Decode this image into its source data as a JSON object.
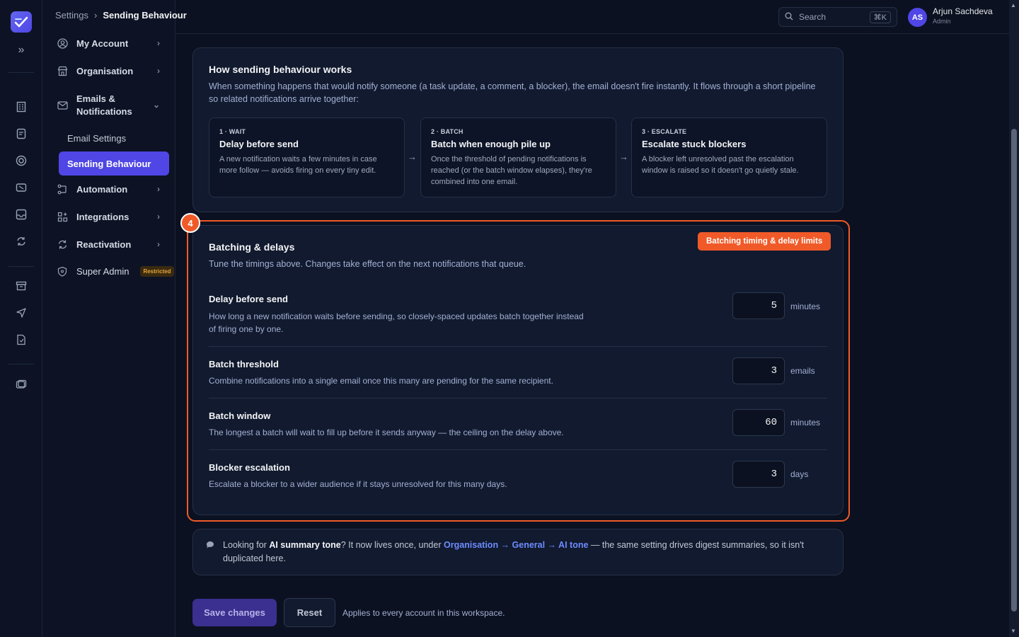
{
  "breadcrumb": {
    "root": "Settings",
    "current": "Sending Behaviour"
  },
  "search": {
    "label": "Search",
    "shortcut": "⌘K"
  },
  "user": {
    "initials": "AS",
    "name": "Arjun Sachdeva",
    "role": "Admin"
  },
  "sidebar": {
    "items": [
      {
        "label": "My Account"
      },
      {
        "label": "Organisation"
      },
      {
        "label": "Emails & Notifications"
      },
      {
        "label": "Email Settings"
      },
      {
        "label": "Sending Behaviour"
      },
      {
        "label": "Automation"
      },
      {
        "label": "Integrations"
      },
      {
        "label": "Reactivation"
      },
      {
        "label": "Super Admin",
        "badge": "Restricted"
      }
    ]
  },
  "how": {
    "title": "How sending behaviour works",
    "description": "When something happens that would notify someone (a task update, a comment, a blocker), the email doesn't fire instantly. It flows through a short pipeline so related notifications arrive together:",
    "steps": [
      {
        "tag": "1 · WAIT",
        "title": "Delay before send",
        "desc": "A new notification waits a few minutes in case more follow — avoids firing on every tiny edit."
      },
      {
        "tag": "2 · BATCH",
        "title": "Batch when enough pile up",
        "desc": "Once the threshold of pending notifications is reached (or the batch window elapses), they're combined into one email."
      },
      {
        "tag": "3 · ESCALATE",
        "title": "Escalate stuck blockers",
        "desc": "A blocker left unresolved past the escalation window is raised so it doesn't go quietly stale."
      }
    ]
  },
  "annotation": {
    "number": "4",
    "label": "Batching timing & delay limits",
    "color": "#f05a28"
  },
  "batching": {
    "title": "Batching & delays",
    "description": "Tune the timings above. Changes take effect on the next notifications that queue.",
    "rows": [
      {
        "title": "Delay before send",
        "desc": "How long a new notification waits before sending, so closely-spaced updates batch together instead of firing one by one.",
        "value": "5",
        "unit": "minutes"
      },
      {
        "title": "Batch threshold",
        "desc": "Combine notifications into a single email once this many are pending for the same recipient.",
        "value": "3",
        "unit": "emails"
      },
      {
        "title": "Batch window",
        "desc": "The longest a batch will wait to fill up before it sends anyway — the ceiling on the delay above.",
        "value": "60",
        "unit": "minutes"
      },
      {
        "title": "Blocker escalation",
        "desc": "Escalate a blocker to a wider audience if it stays unresolved for this many days.",
        "value": "3",
        "unit": "days"
      }
    ]
  },
  "note": {
    "prefix": "Looking for ",
    "bold": "AI summary tone",
    "middle": "? It now lives once, under ",
    "link": "Organisation → General → AI tone",
    "suffix": " — the same setting drives digest summaries, so it isn't duplicated here."
  },
  "actions": {
    "save": "Save changes",
    "reset": "Reset",
    "hint": "Applies to every account in this workspace."
  },
  "colors": {
    "accent": "#4f46e5",
    "highlight": "#f05a28",
    "link": "#6d8bff"
  }
}
